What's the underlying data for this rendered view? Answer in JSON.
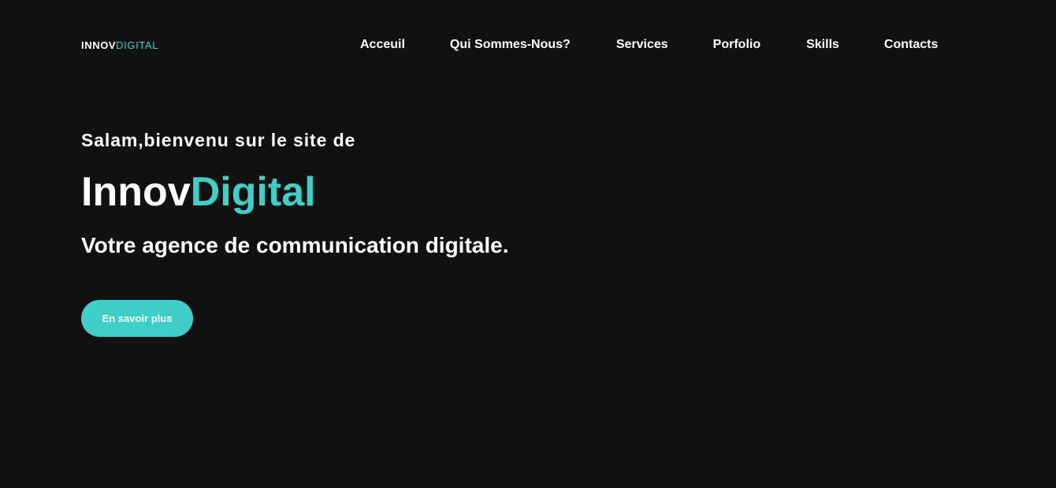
{
  "brand": {
    "primary": "INNOV",
    "accent": "DIGITAL"
  },
  "nav": {
    "items": [
      {
        "label": "Acceuil"
      },
      {
        "label": "Qui Sommes-Nous?"
      },
      {
        "label": "Services"
      },
      {
        "label": "Porfolio"
      },
      {
        "label": "Skills"
      },
      {
        "label": "Contacts"
      }
    ]
  },
  "hero": {
    "greeting": "Salam,bienvenu sur le site de",
    "title_primary": "Innov",
    "title_accent": "Digital",
    "subtitle": "Votre agence de communication digitale.",
    "cta_label": "En savoir plus"
  },
  "colors": {
    "background": "#111111",
    "accent": "#3ecfc8",
    "text": "#ffffff"
  }
}
